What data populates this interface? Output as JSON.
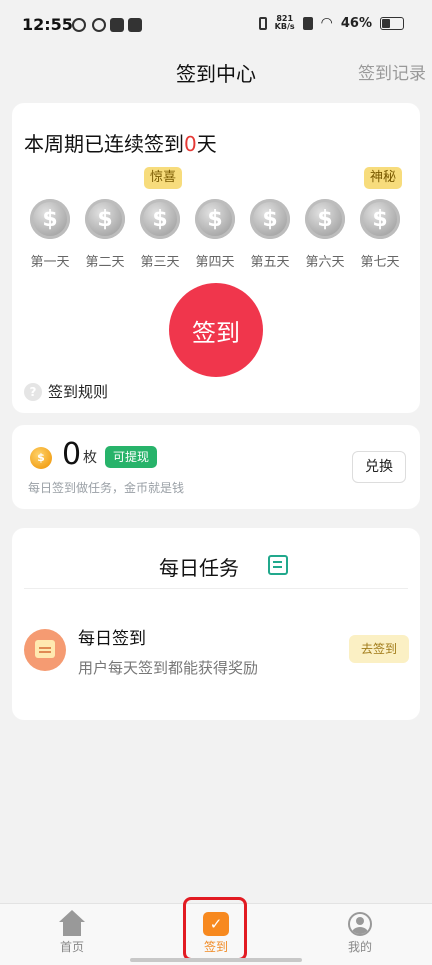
{
  "status_bar": {
    "time": "12:55",
    "net_speed_value": "821",
    "net_speed_unit": "KB/s",
    "battery": "46%"
  },
  "header": {
    "title": "签到中心",
    "records_link": "签到记录"
  },
  "checkin": {
    "streak_prefix": "本周期已连续签到",
    "streak_days": "0",
    "streak_suffix": "天",
    "badge_surprise": "惊喜",
    "badge_mystery": "神秘",
    "days": [
      "第一天",
      "第二天",
      "第三天",
      "第四天",
      "第五天",
      "第六天",
      "第七天"
    ],
    "button_label": "签到",
    "rules_label": "签到规则"
  },
  "wallet": {
    "balance": "0",
    "unit": "枚",
    "withdraw_tag": "可提现",
    "subtitle": "每日签到做任务，金币就是钱",
    "exchange_button": "兑换"
  },
  "tasks": {
    "title": "每日任务",
    "items": [
      {
        "name": "每日签到",
        "description": "用户每天签到都能获得奖励",
        "action": "去签到"
      }
    ]
  },
  "nav": {
    "items": [
      {
        "label": "首页",
        "icon": "home-icon"
      },
      {
        "label": "签到",
        "icon": "calendar-check-icon",
        "active": true
      },
      {
        "label": "我的",
        "icon": "profile-icon"
      }
    ]
  },
  "colors": {
    "accent_red": "#f0364c",
    "accent_green": "#27b36a",
    "nav_active": "#f7891f"
  }
}
